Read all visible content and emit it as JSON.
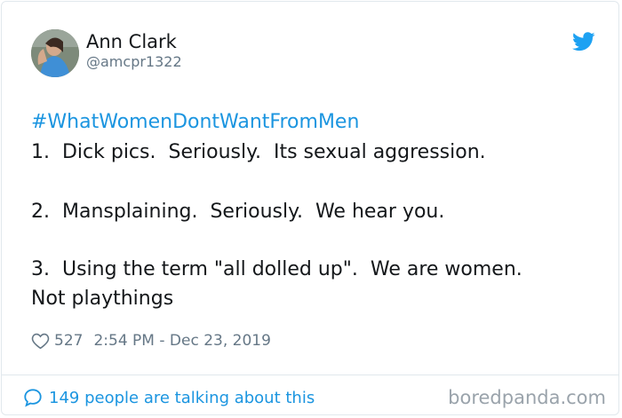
{
  "author": {
    "name": "Ann Clark",
    "handle": "@amcpr1322"
  },
  "tweet": {
    "hashtag": "#WhatWomenDontWantFromMen",
    "lines": [
      "1.  Dick pics.  Seriously.  Its sexual aggression.",
      "2.  Mansplaining.  Seriously.  We hear you.",
      "3.  Using the term \"all dolled up\".  We are women.",
      "Not playthings"
    ]
  },
  "meta": {
    "likes": "527",
    "timestamp": "2:54 PM - Dec 23, 2019"
  },
  "footer": {
    "talking": "149 people are talking about this",
    "watermark": "boredpanda.com"
  },
  "colors": {
    "link": "#1b95e0",
    "text": "#14171a",
    "muted": "#657786",
    "border": "#e1e8ed"
  },
  "icons": {
    "brand": "twitter-bird-icon",
    "like": "heart-icon",
    "reply": "speech-bubble-icon"
  }
}
